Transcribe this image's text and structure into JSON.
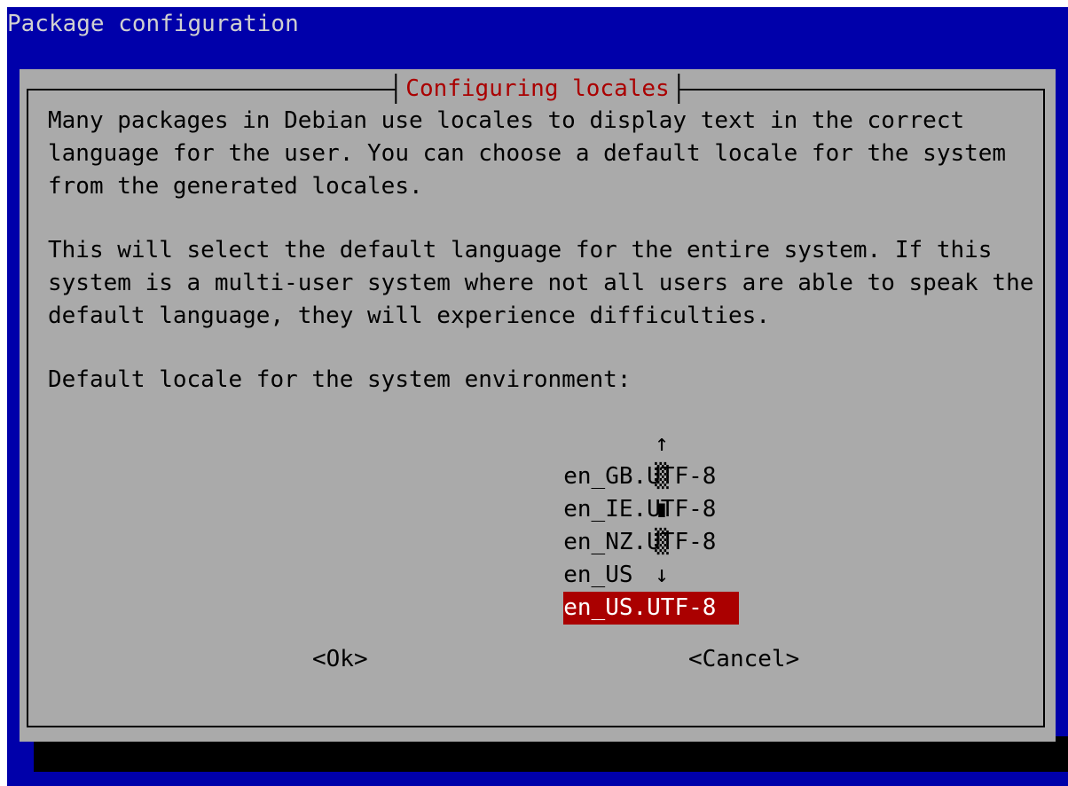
{
  "backtitle": "Package configuration",
  "dialog": {
    "title": "Configuring locales",
    "paragraph1": "Many packages in Debian use locales to display text in the correct\nlanguage for the user. You can choose a default locale for the system\nfrom the generated locales.",
    "paragraph2": "This will select the default language for the entire system. If this\nsystem is a multi-user system where not all users are able to speak the\ndefault language, they will experience difficulties.",
    "prompt": "Default locale for the system environment:"
  },
  "locales": [
    {
      "label": "en_GB.UTF-8",
      "scroll": "↑",
      "selected": false
    },
    {
      "label": "en_IE.UTF-8",
      "scroll": "▒",
      "selected": false
    },
    {
      "label": "en_NZ.UTF-8",
      "scroll": "▮",
      "selected": false
    },
    {
      "label": "en_US",
      "scroll": "▒",
      "selected": false
    },
    {
      "label": "en_US.UTF-8",
      "scroll": "↓",
      "selected": true
    }
  ],
  "buttons": {
    "ok": "<Ok>",
    "cancel": "<Cancel>"
  },
  "colors": {
    "screen_background": "#0000aa",
    "dialog_background": "#aaaaaa",
    "title_color": "#aa0000",
    "selection_background": "#aa0000",
    "selection_text": "#ffffff",
    "shadow": "#000000"
  }
}
